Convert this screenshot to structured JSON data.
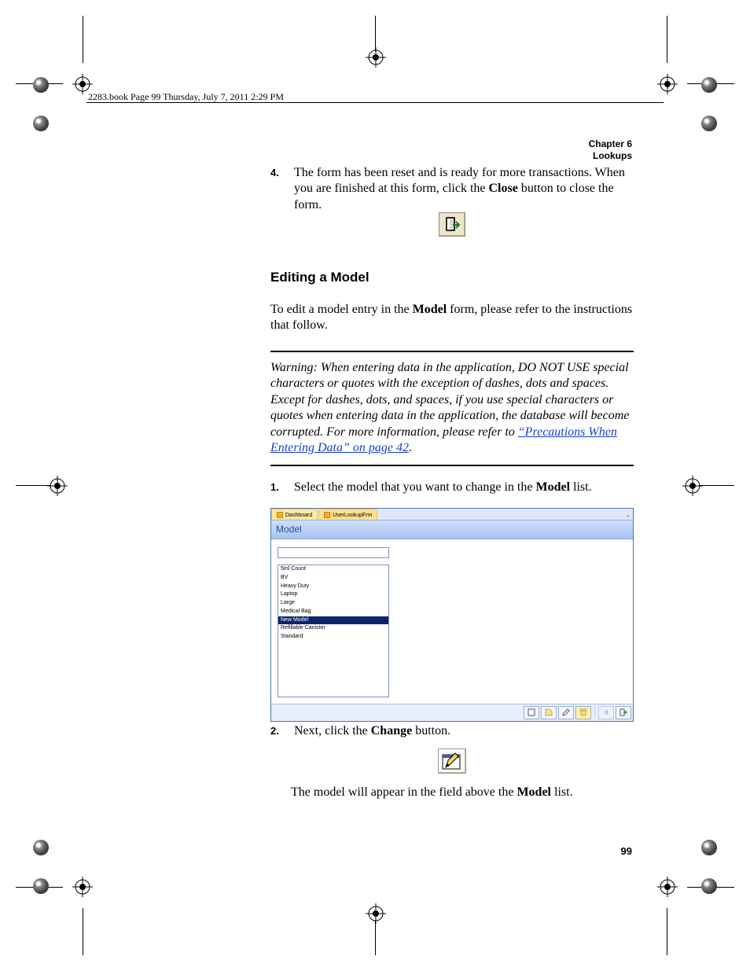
{
  "stamp": "2283.book  Page 99  Thursday, July 7, 2011  2:29 PM",
  "runhead": {
    "chapter": "Chapter 6",
    "section": "Lookups"
  },
  "step4": {
    "num": "4.",
    "text_before": "The form has been reset and is ready for more transactions. When you are finished at this form, click the ",
    "bold": "Close",
    "text_after": " button to close the form."
  },
  "heading": "Editing a Model",
  "intro": {
    "pre": "To edit a model entry in the ",
    "bold": "Model",
    "post": " form, please refer to the instructions that follow."
  },
  "warning": {
    "label": "Warning:",
    "body": "   When entering data in the application, DO NOT USE special characters or quotes with the exception of dashes, dots and spaces. Except for dashes, dots, and spaces, if you use special characters or quotes when entering data in the application, the database will become corrupted. For more information, please refer to ",
    "link": "“Precautions When Entering Data” on page 42",
    "tail": "."
  },
  "step1": {
    "num": "1.",
    "pre": "Select the model that you want to change in the ",
    "bold": "Model",
    "post": " list."
  },
  "screenshot": {
    "tabs": [
      "Dashboard",
      "UserLookupFrm"
    ],
    "title": "Model",
    "list": [
      "5ml Count",
      "BV",
      "Heavy Duty",
      "Laptop",
      "Large",
      "Medical Bag",
      "New Model",
      "Refillable Canister",
      "Standard"
    ],
    "selected": "New Model",
    "statusIcons": [
      "doc-icon",
      "tag-icon",
      "edit-icon",
      "trash-icon",
      "left-icon",
      "exit-icon"
    ]
  },
  "step2": {
    "num": "2.",
    "pre": "Next, click the ",
    "bold": "Change",
    "post": " button."
  },
  "afterChange": {
    "pre": "The model will appear in the field above the ",
    "bold": "Model",
    "post": " list."
  },
  "pageNumber": "99"
}
